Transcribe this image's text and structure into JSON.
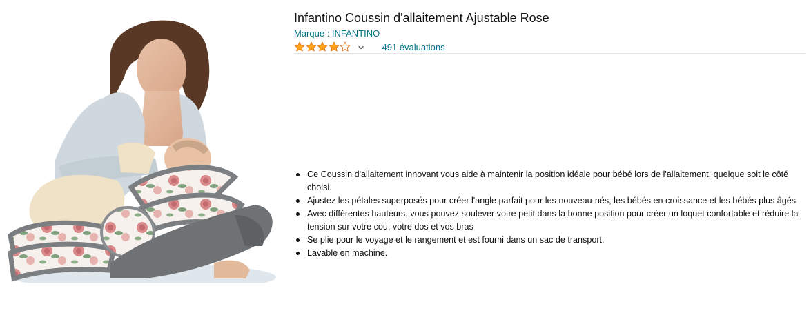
{
  "product": {
    "title": "Infantino Coussin d'allaitement Ajustable Rose",
    "brand_label": "Marque : INFANTINO",
    "rating": {
      "value": 4.0,
      "max": 5,
      "star_color": "#FFA41C",
      "star_outline": "#DE7921",
      "reviews_text": "491 évaluations"
    },
    "features": [
      "Ce Coussin d'allaitement innovant vous aide à maintenir la position idéale pour bébé lors de l'allaitement, quelque soit le côté choisi.",
      "Ajustez les pétales superposés pour créer l'angle parfait pour les nouveau-nés, les bébés en croissance et les bébés plus âgés",
      "Avec différentes hauteurs, vous pouvez soulever votre petit dans la bonne position pour créer un loquet confortable et réduire la tension sur votre cou, votre dos et vos bras",
      "Se plie pour le voyage et le rangement et est fourni dans un sac de transport.",
      "Lavable en machine."
    ]
  },
  "colors": {
    "link": "#007185",
    "text": "#0F1111",
    "divider": "#E7E7E7"
  }
}
